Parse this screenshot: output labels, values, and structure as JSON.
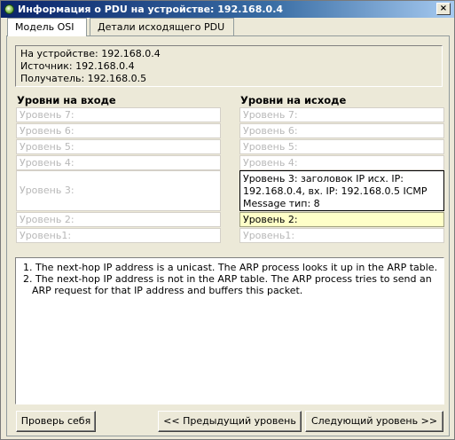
{
  "window": {
    "title": "Информация о PDU на устройстве: 192.168.0.4",
    "close_label": "×"
  },
  "tabs": [
    {
      "label": "Модель OSI"
    },
    {
      "label": "Детали исходящего PDU"
    }
  ],
  "info": {
    "device": "На устройстве: 192.168.0.4",
    "source": "Источник: 192.168.0.4",
    "destination": "Получатель: 192.168.0.5"
  },
  "in_layers": {
    "heading": "Уровни на входе",
    "l7": "Уровень 7:",
    "l6": "Уровень 6:",
    "l5": "Уровень 5:",
    "l4": "Уровень 4:",
    "l3": "Уровень 3:",
    "l2": "Уровень 2:",
    "l1": "Уровень1:"
  },
  "out_layers": {
    "heading": "Уровни на исходе",
    "l7": "Уровень 7:",
    "l6": "Уровень 6:",
    "l5": "Уровень 5:",
    "l4": "Уровень 4:",
    "l3": "Уровень 3: заголовок IP исх. IP: 192.168.0.4, вх. IP: 192.168.0.5 ICMP Message тип: 8",
    "l2": "Уровень 2:",
    "l1": "Уровень1:"
  },
  "description": {
    "item1": "1. The next-hop IP address is a unicast. The ARP process looks it up in the ARP table.",
    "item2": "2. The next-hop IP address is not in the ARP table. The ARP process tries to send an ARP request for that IP address and buffers this packet."
  },
  "buttons": {
    "check": "Проверь себя",
    "prev": "<< Предыдущий уровень",
    "next": "Следующий уровень >>"
  },
  "colors": {
    "active_layer_bg": "#ffffc8",
    "inactive_text": "#b8b8b8",
    "titlebar": "#0a246a"
  }
}
